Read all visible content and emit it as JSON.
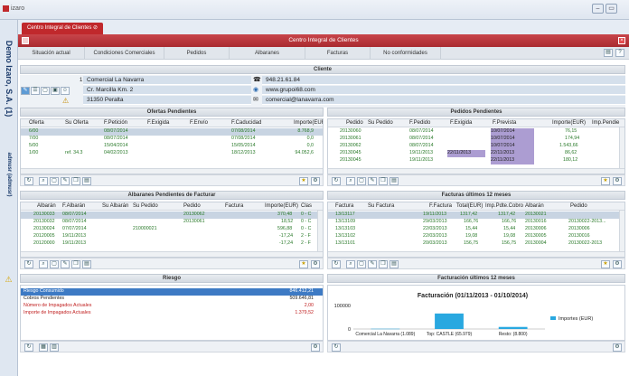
{
  "app": {
    "name": "izaro"
  },
  "sidebar": {
    "company": "Demo Izaro, S.A. (1)",
    "user": "admusr (admusr)"
  },
  "tab": {
    "label": "Centro Integral de Clientes"
  },
  "window": {
    "title": "Centro Integral de Clientes"
  },
  "nav": [
    "Situación actual",
    "Condiciones Comerciales",
    "Pedidos",
    "Albaranes",
    "Facturas",
    "No conformidades"
  ],
  "cliente": {
    "header": "Cliente",
    "codigo": "1",
    "nombre": "Comercial La Navarra",
    "direccion": "Cr. Marcilla Km. 2",
    "cp": "31350 Peralta",
    "telefono": "948.21.61.84",
    "web": "www.grupoi68.com",
    "email": "comercial@lanavarra.com"
  },
  "ofertas": {
    "header": "Ofertas Pendientes",
    "cols": [
      "Oferta",
      "Su Oferta",
      "F.Petición",
      "F.Exigida",
      "F.Envío",
      "F.Caducidad",
      "Importe(EUR)"
    ],
    "rows": [
      [
        "6/00",
        "",
        "08/07/2014",
        "",
        "",
        "07/08/2014",
        "8.768,9"
      ],
      [
        "7/00",
        "",
        "08/07/2014",
        "",
        "",
        "07/08/2014",
        "0,0"
      ],
      [
        "5/00",
        "",
        "15/04/2014",
        "",
        "",
        "15/05/2014",
        "0,0"
      ],
      [
        "1/00",
        "ref. 34.3",
        "04/02/2013",
        "",
        "",
        "18/12/2013",
        "94.052,6"
      ]
    ]
  },
  "pedidos": {
    "header": "Pedidos Pendientes",
    "cols": [
      "Pedido",
      "Su Pedido",
      "F.Pedido",
      "F.Exigida",
      "F.Prevista",
      "Importe(EUR)",
      "Imp.Pendie"
    ],
    "rows": [
      [
        "20130060",
        "",
        "08/07/2014",
        "",
        "10/07/2014",
        "76,15",
        ""
      ],
      [
        "20130061",
        "",
        "08/07/2014",
        "",
        "10/07/2014",
        "174,94",
        ""
      ],
      [
        "20130062",
        "",
        "08/07/2014",
        "",
        "10/07/2014",
        "1.543,66",
        ""
      ],
      [
        "20130045",
        "",
        "19/11/2013",
        "22/11/2013",
        "22/11/2013",
        "86,62",
        ""
      ],
      [
        "20130045",
        "",
        "19/11/2013",
        "",
        "22/11/2013",
        "180,12",
        ""
      ]
    ]
  },
  "albaranes": {
    "header": "Albaranes Pendientes de Facturar",
    "cols": [
      "Albarán",
      "F.Albarán",
      "Su Albarán",
      "Su Pedido",
      "Pedido",
      "Factura",
      "Importe(EUR)",
      "Clas"
    ],
    "rows": [
      [
        "20130033",
        "08/07/2014",
        "",
        "",
        "20130062",
        "",
        "370,48",
        "0 - C"
      ],
      [
        "20130032",
        "08/07/2014",
        "",
        "",
        "20130061",
        "",
        "18,52",
        "0 - C"
      ],
      [
        "20130024",
        "07/07/2014",
        "",
        "210000021",
        "",
        "",
        "596,88",
        "0 - C"
      ],
      [
        "20120005",
        "19/11/2013",
        "",
        "",
        "",
        "",
        "-17,24",
        "2 - F"
      ],
      [
        "20120000",
        "19/11/2013",
        "",
        "",
        "",
        "",
        "-17,24",
        "2 - F"
      ]
    ]
  },
  "facturas": {
    "header": "Facturas últimos 12 meses",
    "cols": [
      "Factura",
      "Su Factura",
      "F.Factura",
      "Total(EUR)",
      "Imp.Pdte.Cobro",
      "Albarán",
      "Pedido"
    ],
    "rows": [
      [
        "13/13117",
        "",
        "19/11/2013",
        "1317,42",
        "1317,42",
        "20130021",
        ""
      ],
      [
        "13/13109",
        "",
        "29/03/2013",
        "166,76",
        "166,76",
        "20130016",
        "20130022-2013..."
      ],
      [
        "13/13103",
        "",
        "22/03/2013",
        "15,44",
        "15,44",
        "20130006",
        "20130006"
      ],
      [
        "13/13102",
        "",
        "22/03/2013",
        "19,08",
        "19,08",
        "20130005",
        "20130016"
      ],
      [
        "13/13101",
        "",
        "20/03/2013",
        "156,75",
        "156,75",
        "20130004",
        "20130022-2013"
      ]
    ]
  },
  "riesgo": {
    "header": "Riesgo",
    "rows": [
      {
        "label": "Riesgo Consumido",
        "value": "846.412,21"
      },
      {
        "label": "Cobros Pendientes",
        "value": "509.646,81"
      },
      {
        "label": "Número de Impagados Actuales",
        "value": "2,00"
      },
      {
        "label": "Importe de Impagados Actuales",
        "value": "1.379,52"
      }
    ]
  },
  "facturacion": {
    "header": "Facturación últimos 12 meses"
  },
  "chart_data": {
    "type": "bar",
    "title": "Facturación (01/11/2013 - 01/10/2014)",
    "categories": [
      "Comercial La Navarra (1.089)",
      "Top: CASTLE (65.979)",
      "Resto: (8.800)"
    ],
    "series": [
      {
        "name": "Importes (EUR)",
        "values": [
          1089,
          65979,
          8800
        ]
      }
    ],
    "ylim": [
      0,
      100000
    ],
    "yticks": [
      0,
      100000
    ],
    "colors": {
      "bar": "#29a8e0"
    },
    "legend": "right"
  }
}
